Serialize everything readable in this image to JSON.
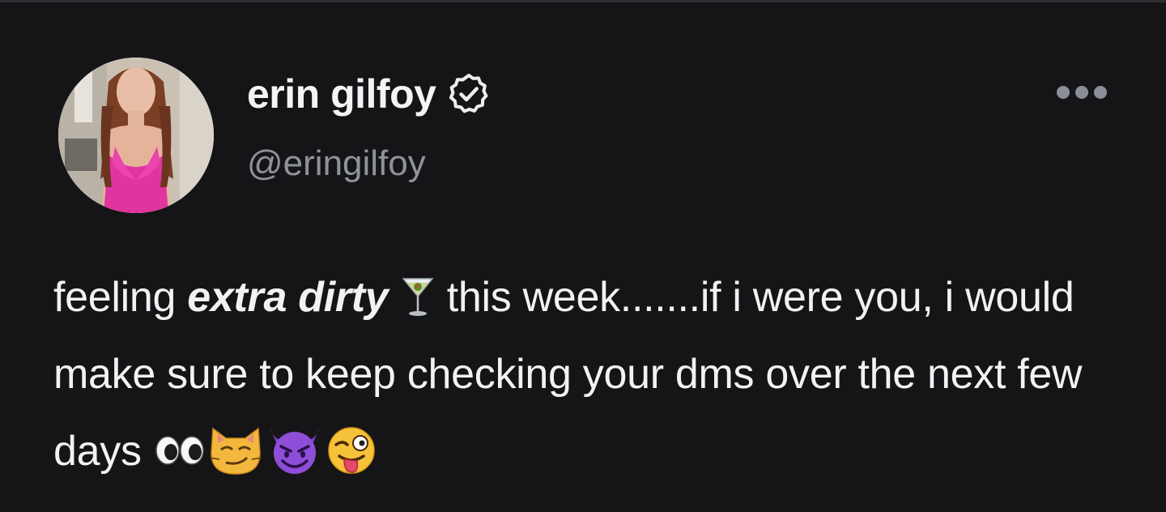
{
  "post": {
    "author": {
      "display_name": "erin gilfoy",
      "handle": "@eringilfoy",
      "verified": true,
      "avatar_icon": "profile-photo"
    },
    "menu": {
      "icon": "more-horizontal-icon"
    },
    "text": {
      "part1": "feeling ",
      "emphasis": "extra dirty",
      "part2": " ",
      "part3": " this week.......if i were you, i would make sure to keep checking your dms over the next few days ",
      "emojis": [
        "martini-glass",
        "eyes",
        "smirking-cat",
        "smiling-devil",
        "winking-tongue-face"
      ]
    }
  },
  "colors": {
    "background": "#151518",
    "text": "#f2f2f4",
    "handle": "#8e929b",
    "menu_dots": "#8a8e96"
  }
}
